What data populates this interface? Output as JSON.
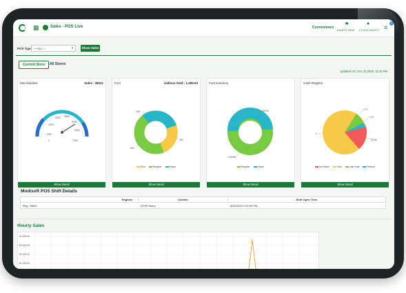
{
  "header": {
    "app_title": "Sales - POS Live",
    "convenience": "Convenience",
    "whats_new": "WHAT'S NEW",
    "clock_in_out": "CLOCK IN/OUT",
    "help": "?"
  },
  "filters": {
    "pos_type_label": "POS Type",
    "pos_type_value": "---ALL---",
    "show_sales_label": "Show Sales"
  },
  "tabs": [
    {
      "label": "Current Store",
      "active": true
    },
    {
      "label": "All Stores",
      "active": false
    }
  ],
  "updated_text": "Updated On: Dec 31 2025, 11:33 PM",
  "colors": {
    "brand_green": "#1a7a3a",
    "teal": "#29b5c8",
    "lime": "#7ac943",
    "yellow": "#f7c948",
    "red": "#f05a5a"
  },
  "cards": {
    "merchandise": {
      "title": "Merchandise",
      "stat": "Sales : $8111",
      "gauge_ticks": [
        "1000",
        "2000",
        "3000",
        "4000",
        "5000",
        "6000",
        "7000",
        "0"
      ],
      "gauge_value": 5100,
      "gauge_max": 7000,
      "button": "Show Detail"
    },
    "fuel": {
      "title": "Fuel",
      "stat": "Gallons Sold : 1,455.63",
      "labels": [
        "438",
        "382",
        "564"
      ],
      "legend": [
        "Plus",
        "Regular",
        "Super"
      ],
      "button": "Show Detail"
    },
    "fuel_inventory": {
      "title": "Fuel Inventory",
      "labels": [
        "16239",
        "326284"
      ],
      "legend": [
        "Regular",
        "Super"
      ],
      "button": "Show Detail"
    },
    "cash_register": {
      "title": "Cash Register",
      "labels": [
        "4.37",
        "7.15",
        "28.66",
        "4"
      ],
      "legend": [
        "No Sales",
        "Void",
        "Last Void",
        "Refund"
      ],
      "button": "Show Detail"
    }
  },
  "shift_details": {
    "title": "Modisoft POS Shift Details",
    "columns": [
      "Register",
      "Cashier",
      "Shift Open Time"
    ],
    "rows": [
      {
        "register": "Reg. 25681",
        "cashier": "NTEP Barry",
        "open_time": "8/30/2025 2:04:35 PM"
      }
    ]
  },
  "hourly": {
    "title": "Hourly Sales",
    "y_ticks": [
      "$4,000.00",
      "$3,000.00",
      "$2,000.00",
      "$1,000.00"
    ]
  },
  "icons": [
    "logo-ring-icon",
    "apps-grid-icon",
    "store-icon",
    "whats-new-icon",
    "clock-icon",
    "menu-icon",
    "help-icon",
    "sort-icon",
    "caret-down-icon"
  ]
}
